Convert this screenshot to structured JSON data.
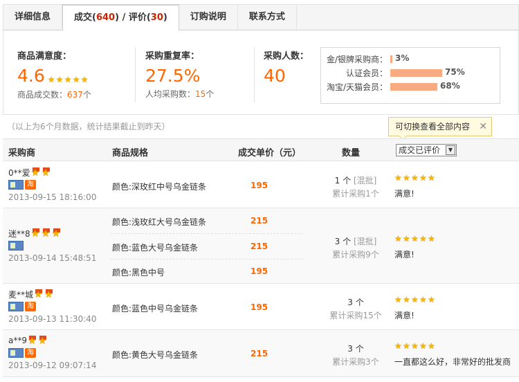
{
  "tabs": [
    {
      "label": "详细信息"
    },
    {
      "label_prefix": "成交(",
      "trade_count": "640",
      "label_mid": ") / 评价(",
      "review_count": "30",
      "label_suffix": ")"
    },
    {
      "label": "订购说明"
    },
    {
      "label": "联系方式"
    }
  ],
  "summary": {
    "satisfaction": {
      "title": "商品满意度：",
      "value": "4.6",
      "stars": 5,
      "sub_label": "商品成交数：",
      "sub_value": "637",
      "sub_unit": "个"
    },
    "repurchase": {
      "title": "采购重复率：",
      "value": "27.5%",
      "sub_label": "人均采购数：",
      "sub_value": "15",
      "sub_unit": "个"
    },
    "buyers": {
      "title": "采购人数：",
      "value": "40"
    },
    "members": [
      {
        "label": "金/银牌采购商：",
        "pct": "3%",
        "fraction": 0.03
      },
      {
        "label": "认证会员：",
        "pct": "75%",
        "fraction": 0.75
      },
      {
        "label": "淘宝/天猫会员：",
        "pct": "68%",
        "fraction": 0.68
      }
    ]
  },
  "note": "（以上为6个月数据，统计结果截止到昨天）",
  "tooltip": {
    "text": "可切换查看全部内容",
    "close": "✕"
  },
  "table": {
    "headers": {
      "buyer": "采购商",
      "spec": "商品规格",
      "price": "成交单价（元）",
      "qty": "数量"
    },
    "filter": {
      "selected": "成交已评价"
    },
    "rows": [
      {
        "buyer": "0**爱",
        "medals": 2,
        "tao": "淘",
        "date": "2013-09-15 18:16:00",
        "items": [
          {
            "spec": "颜色:深玫红中号乌金链条",
            "price": "195"
          }
        ],
        "qty": "1 个",
        "mix": "[混批]",
        "cum": "累计采购1个",
        "stars": 5,
        "review": "满意!"
      },
      {
        "buyer": "迷**8",
        "medals": 3,
        "tao": "",
        "date": "2013-09-14 15:48:51",
        "items": [
          {
            "spec": "颜色:浅玫红大号乌金链条",
            "price": "215"
          },
          {
            "spec": "颜色:蓝色大号乌金链条",
            "price": "215"
          },
          {
            "spec": "颜色:黑色中号",
            "price": "195"
          }
        ],
        "qty": "3 个",
        "mix": "[混批]",
        "cum": "累计采购9个",
        "stars": 5,
        "review": "满意!"
      },
      {
        "buyer": "麦**城",
        "medals": 2,
        "tao": "淘",
        "date": "2013-09-13 11:30:40",
        "items": [
          {
            "spec": "颜色:蓝色中号乌金链条",
            "price": "195"
          }
        ],
        "qty": "3 个",
        "mix": "",
        "cum": "累计采购15个",
        "stars": 5,
        "review": "满意!"
      },
      {
        "buyer": "a**9",
        "medals": 2,
        "tao": "淘",
        "date": "2013-09-12 09:07:14",
        "items": [
          {
            "spec": "颜色:黄色大号乌金链条",
            "price": "215"
          }
        ],
        "qty": "3 个",
        "mix": "",
        "cum": "累计采购3个",
        "stars": 5,
        "review": "一直都这么好，非常好的批发商"
      }
    ]
  }
}
